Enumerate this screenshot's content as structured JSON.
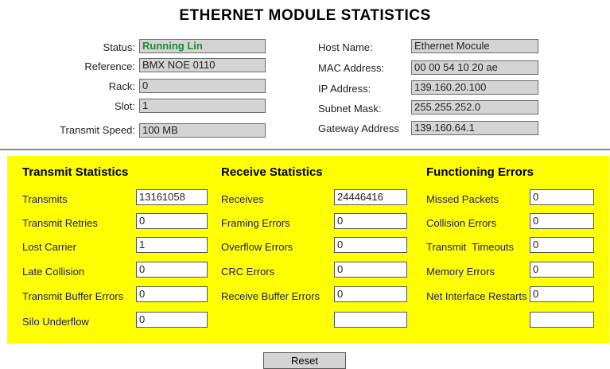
{
  "title": "ETHERNET MODULE STATISTICS",
  "info_left": [
    {
      "label": "Status:",
      "value": "Running Lin"
    },
    {
      "label": "Reference:",
      "value": "BMX NOE 0110"
    },
    {
      "label": "Rack:",
      "value": "0"
    },
    {
      "label": "Slot:",
      "value": "1"
    },
    {
      "label": "Transmit Speed:",
      "value": "100 MB"
    }
  ],
  "info_right": [
    {
      "label": "Host Name:",
      "value": "Ethernet Mocule"
    },
    {
      "label": "MAC Address:",
      "value": "00 00 54 10 20 ae"
    },
    {
      "label": "IP Address:",
      "value": "139.160.20.100"
    },
    {
      "label": "Subnet Mask:",
      "value": "255.255.252.0"
    },
    {
      "label": "Gateway Address",
      "value": "139.160.64.1"
    }
  ],
  "transmit": {
    "heading": "Transmit Statistics",
    "rows": [
      {
        "label": "Transmits",
        "value": "13161058"
      },
      {
        "label": "Transmit Retries",
        "value": "0"
      },
      {
        "label": "Lost Carrier",
        "value": "1"
      },
      {
        "label": "Late Collision",
        "value": "0"
      },
      {
        "label": "Transmit Buffer Errors",
        "value": "0"
      },
      {
        "label": "Silo Underflow",
        "value": "0"
      }
    ]
  },
  "receive": {
    "heading": "Receive Statistics",
    "rows": [
      {
        "label": "Receives",
        "value": "24446416"
      },
      {
        "label": "Framing Errors",
        "value": "0"
      },
      {
        "label": "Overflow Errors",
        "value": "0"
      },
      {
        "label": "CRC Errors",
        "value": "0"
      },
      {
        "label": "Receive Buffer Errors",
        "value": "0"
      },
      {
        "label": "",
        "value": ""
      }
    ]
  },
  "errors": {
    "heading": "Functioning Errors",
    "rows": [
      {
        "label": "Missed Packets",
        "value": "0"
      },
      {
        "label": "Collision Errors",
        "value": "0"
      },
      {
        "label": "Transmit  Timeouts",
        "value": "0"
      },
      {
        "label": "Memory Errors",
        "value": "0"
      },
      {
        "label": "Net Interface Restarts",
        "value": "0"
      },
      {
        "label": "",
        "value": ""
      }
    ]
  },
  "reset_label": "Reset",
  "colors": {
    "panel": "#ffff00",
    "status_text": "#1f8a3a",
    "readonly_field": "#d4d4d4"
  }
}
